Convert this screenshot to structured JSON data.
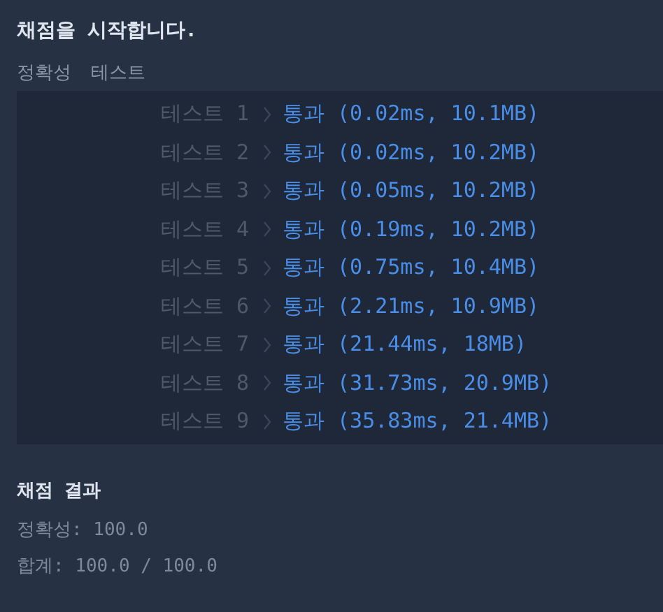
{
  "heading": "채점을 시작합니다.",
  "columns": [
    "정확성",
    "테스트"
  ],
  "tests": [
    {
      "label": "테스트 1",
      "result": "통과 (0.02ms, 10.1MB)"
    },
    {
      "label": "테스트 2",
      "result": "통과 (0.02ms, 10.2MB)"
    },
    {
      "label": "테스트 3",
      "result": "통과 (0.05ms, 10.2MB)"
    },
    {
      "label": "테스트 4",
      "result": "통과 (0.19ms, 10.2MB)"
    },
    {
      "label": "테스트 5",
      "result": "통과 (0.75ms, 10.4MB)"
    },
    {
      "label": "테스트 6",
      "result": "통과 (2.21ms, 10.9MB)"
    },
    {
      "label": "테스트 7",
      "result": "통과 (21.44ms, 18MB)"
    },
    {
      "label": "테스트 8",
      "result": "통과 (31.73ms, 20.9MB)"
    },
    {
      "label": "테스트 9",
      "result": "통과 (35.83ms, 21.4MB)"
    }
  ],
  "summary": {
    "title": "채점 결과",
    "lines": [
      "정확성: 100.0",
      "합계: 100.0 / 100.0"
    ]
  }
}
